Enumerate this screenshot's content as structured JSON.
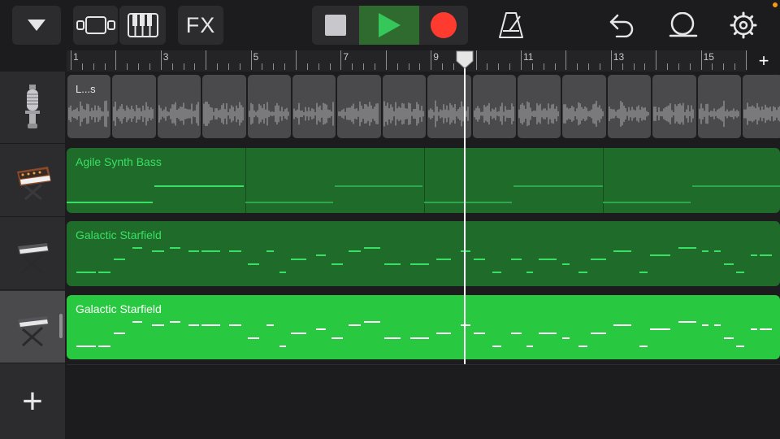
{
  "toolbar": {
    "browser_icon": "triangle-down-icon",
    "tracks_view_icon": "tracks-view-icon",
    "keyboard_icon": "keyboard-icon",
    "fx_label": "FX",
    "stop_icon": "stop-icon",
    "play_icon": "play-icon",
    "record_icon": "record-icon",
    "metronome_icon": "metronome-icon",
    "undo_icon": "undo-icon",
    "loop_icon": "loop-icon",
    "settings_icon": "gear-icon",
    "colors": {
      "play_bg": "#2f6b2f",
      "play": "#35c759",
      "record": "#ff3b30",
      "stop": "#c7c7cc"
    }
  },
  "ruler": {
    "bars": [
      "1",
      "3",
      "5",
      "7",
      "9",
      "11",
      "13",
      "15"
    ],
    "add_label": "+",
    "playhead_bar": 9.8
  },
  "tracks": [
    {
      "instrument_icon": "microphone-icon",
      "region_label": "L...s",
      "type": "audio",
      "selected": false,
      "color": "#4a4a4c"
    },
    {
      "instrument_icon": "synth-keyboard-icon",
      "region_label": "Agile Synth Bass",
      "type": "midi",
      "selected": false,
      "color": "#1f6b2a"
    },
    {
      "instrument_icon": "keyboard-stand-icon",
      "region_label": "Galactic Starfield",
      "type": "midi",
      "selected": false,
      "color": "#1f6b2a"
    },
    {
      "instrument_icon": "keyboard-stand-icon",
      "region_label": "Galactic Starfield",
      "type": "midi",
      "selected": true,
      "color": "#28c840"
    }
  ],
  "add_track_label": "+",
  "colors": {
    "region_dark": "#1f6b2a",
    "region_bright": "#28c840",
    "note_dark": "#3ae065",
    "note_on_bright": "#ffffff",
    "background": "#1c1c1e"
  }
}
